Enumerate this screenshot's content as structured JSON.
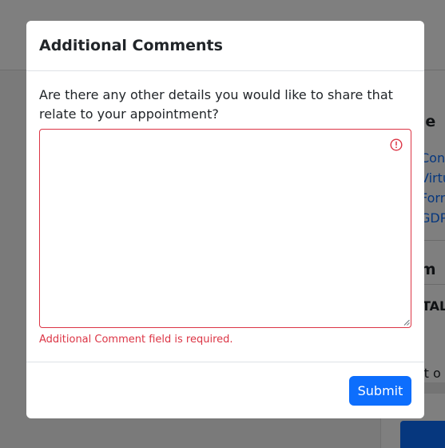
{
  "background": {
    "section_heading_1": "age",
    "links": [
      "Cons",
      "Virtu",
      "Form",
      "GDP"
    ],
    "section_heading_2": "mm",
    "bold_text": "TAL",
    "partial_text": "dit o"
  },
  "modal": {
    "title": "Additional Comments",
    "question": "Are there any other details you would like to share that relate to your appointment?",
    "comment_value": "",
    "error_message": "Additional Comment field is required.",
    "submit_label": "Submit"
  },
  "colors": {
    "primary": "#0d6efd",
    "danger": "#dc3545"
  }
}
